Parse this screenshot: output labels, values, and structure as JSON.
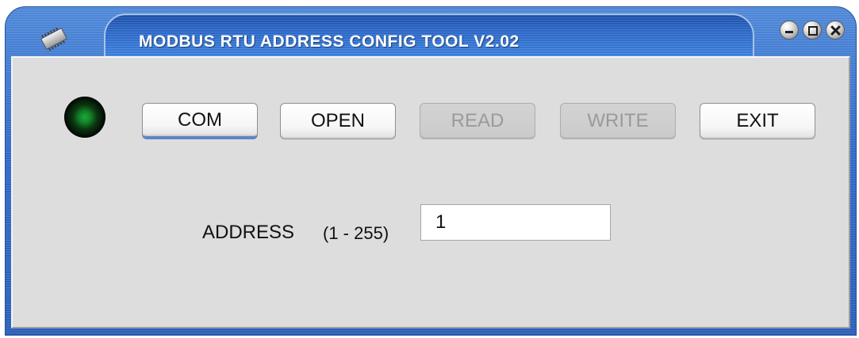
{
  "window": {
    "title": "MODBUS RTU ADDRESS CONFIG TOOL V2.02",
    "icon": "chip-icon",
    "controls": {
      "minimize_icon": "minimize-icon",
      "maximize_icon": "maximize-icon",
      "close_icon": "close-icon"
    }
  },
  "toolbar": {
    "status_indicator": {
      "color": "#16a136"
    },
    "buttons": {
      "com": "COM",
      "open": "OPEN",
      "read": "READ",
      "write": "WRITE",
      "exit": "EXIT"
    },
    "disabled": [
      "READ",
      "WRITE"
    ]
  },
  "form": {
    "address_label": "ADDRESS",
    "address_range": "(1 - 255)",
    "address_value": "1"
  },
  "colors": {
    "title_blue": "#2a66c6",
    "panel_gray": "#dddddd",
    "focused_button_accent": "#5f83c6"
  }
}
